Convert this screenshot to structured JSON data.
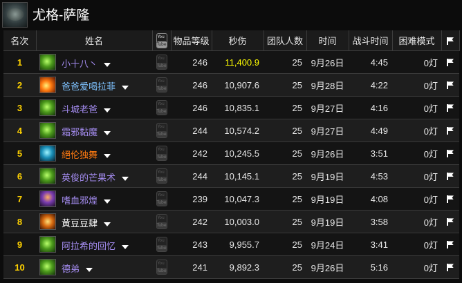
{
  "boss": {
    "title": "尤格-萨隆",
    "icon": "yogg-saron-boss-icon"
  },
  "headers": {
    "rank": "名次",
    "name": "姓名",
    "youtube_icon": "youtube-icon",
    "item_level": "物品等级",
    "dps": "秒伤",
    "raid_size": "团队人数",
    "date": "时间",
    "fight_time": "战斗时间",
    "hard_mode": "困难模式",
    "flag_icon": "flag-icon"
  },
  "colors": {
    "rank": "#ffd200",
    "dps_top": "#ffff00",
    "class_priest": "#b07cff",
    "class_hunter": "#7fb8ff",
    "class_paladin": "#f58cba",
    "class_mage": "#69ccf0",
    "class_rogue": "#fff569",
    "class_shaman": "#ff7d0a"
  },
  "rows": [
    {
      "rank": "1",
      "name": "小十八丶",
      "icon": "green-skull-icon",
      "name_color": "#a48cf0",
      "item_level": "246",
      "dps": "11,400.9",
      "dps_color": "#ffff00",
      "raid_size": "25",
      "date": "9月26日",
      "fight_time": "4:45",
      "hard_mode": "0灯"
    },
    {
      "rank": "2",
      "name": "爸爸爱喝拉菲",
      "icon": "fire-icon",
      "name_color": "#7ec2ff",
      "item_level": "246",
      "dps": "10,907.6",
      "dps_color": "#e8e8e8",
      "raid_size": "25",
      "date": "9月28日",
      "fight_time": "4:22",
      "hard_mode": "0灯"
    },
    {
      "rank": "3",
      "name": "斗城老爸",
      "icon": "green-skull-icon",
      "name_color": "#a48cf0",
      "item_level": "246",
      "dps": "10,835.1",
      "dps_color": "#e8e8e8",
      "raid_size": "25",
      "date": "9月27日",
      "fight_time": "4:16",
      "hard_mode": "0灯"
    },
    {
      "rank": "4",
      "name": "霜邪黏魔",
      "icon": "green-skull-icon",
      "name_color": "#a48cf0",
      "item_level": "244",
      "dps": "10,574.2",
      "dps_color": "#e8e8e8",
      "raid_size": "25",
      "date": "9月27日",
      "fight_time": "4:49",
      "hard_mode": "0灯"
    },
    {
      "rank": "5",
      "name": "絕伦独舞",
      "icon": "blue-beast-icon",
      "name_color": "#ff7a10",
      "item_level": "242",
      "dps": "10,245.5",
      "dps_color": "#e8e8e8",
      "raid_size": "25",
      "date": "9月26日",
      "fight_time": "3:51",
      "hard_mode": "0灯"
    },
    {
      "rank": "6",
      "name": "英俊的芒果术",
      "icon": "green-skull-icon",
      "name_color": "#a48cf0",
      "item_level": "244",
      "dps": "10,145.1",
      "dps_color": "#e8e8e8",
      "raid_size": "25",
      "date": "9月19日",
      "fight_time": "4:53",
      "hard_mode": "0灯"
    },
    {
      "rank": "7",
      "name": "嗜血邪煌",
      "icon": "demon-icon",
      "name_color": "#a48cf0",
      "item_level": "239",
      "dps": "10,047.3",
      "dps_color": "#e8e8e8",
      "raid_size": "25",
      "date": "9月19日",
      "fight_time": "4:08",
      "hard_mode": "0灯"
    },
    {
      "rank": "8",
      "name": "黄豆豆肆",
      "icon": "flaming-skull-icon",
      "name_color": "#ffffff",
      "item_level": "242",
      "dps": "10,003.0",
      "dps_color": "#e8e8e8",
      "raid_size": "25",
      "date": "9月19日",
      "fight_time": "3:58",
      "hard_mode": "0灯"
    },
    {
      "rank": "9",
      "name": "阿拉希的回忆",
      "icon": "green-skull-icon",
      "name_color": "#a48cf0",
      "item_level": "243",
      "dps": "9,955.7",
      "dps_color": "#e8e8e8",
      "raid_size": "25",
      "date": "9月24日",
      "fight_time": "3:41",
      "hard_mode": "0灯"
    },
    {
      "rank": "10",
      "name": "德弟",
      "icon": "green-skull-icon",
      "name_color": "#a48cf0",
      "item_level": "241",
      "dps": "9,892.3",
      "dps_color": "#e8e8e8",
      "raid_size": "25",
      "date": "9月26日",
      "fight_time": "5:16",
      "hard_mode": "0灯"
    }
  ]
}
